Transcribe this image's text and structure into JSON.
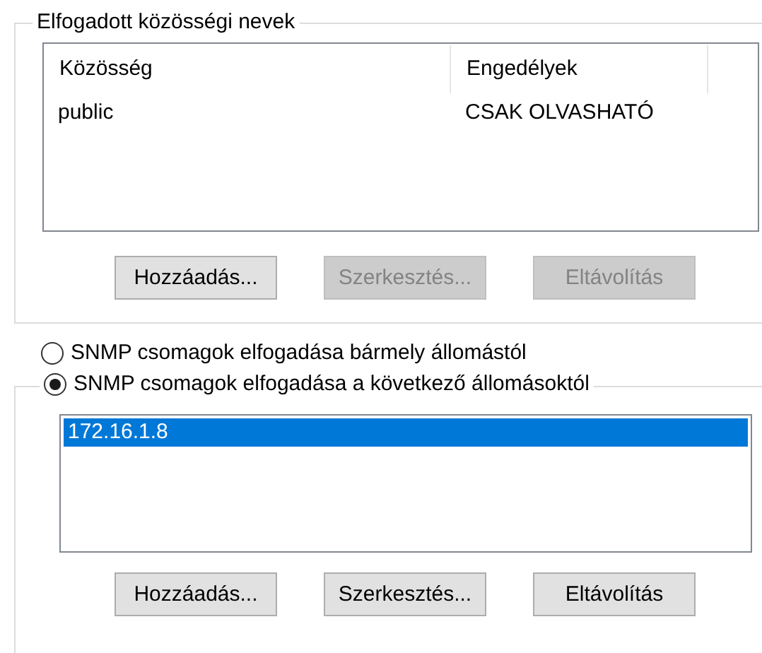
{
  "community_group": {
    "title": "Elfogadott közösségi nevek",
    "table": {
      "columns": [
        "Közösség",
        "Engedélyek"
      ],
      "rows": [
        [
          "public",
          "CSAK OLVASHATÓ"
        ]
      ]
    },
    "buttons": [
      {
        "label": "Hozzáadás...",
        "disabled": false
      },
      {
        "label": "Szerkesztés...",
        "disabled": true
      },
      {
        "label": "Eltávolítás",
        "disabled": true
      }
    ]
  },
  "host_options": [
    {
      "label": "SNMP csomagok elfogadása bármely állomástól",
      "kind": "plain",
      "selected": false
    },
    {
      "label": "SNMP csomagok elfogadása a következő állomásoktól",
      "kind": "group_header",
      "selected": true
    }
  ],
  "host_list": {
    "items": [
      {
        "text": "172.16.1.8",
        "selected": true
      }
    ]
  },
  "host_buttons": [
    {
      "label": "Hozzáadás...",
      "disabled": false
    },
    {
      "label": "Szerkesztés...",
      "disabled": false
    },
    {
      "label": "Eltávolítás",
      "disabled": false
    }
  ]
}
